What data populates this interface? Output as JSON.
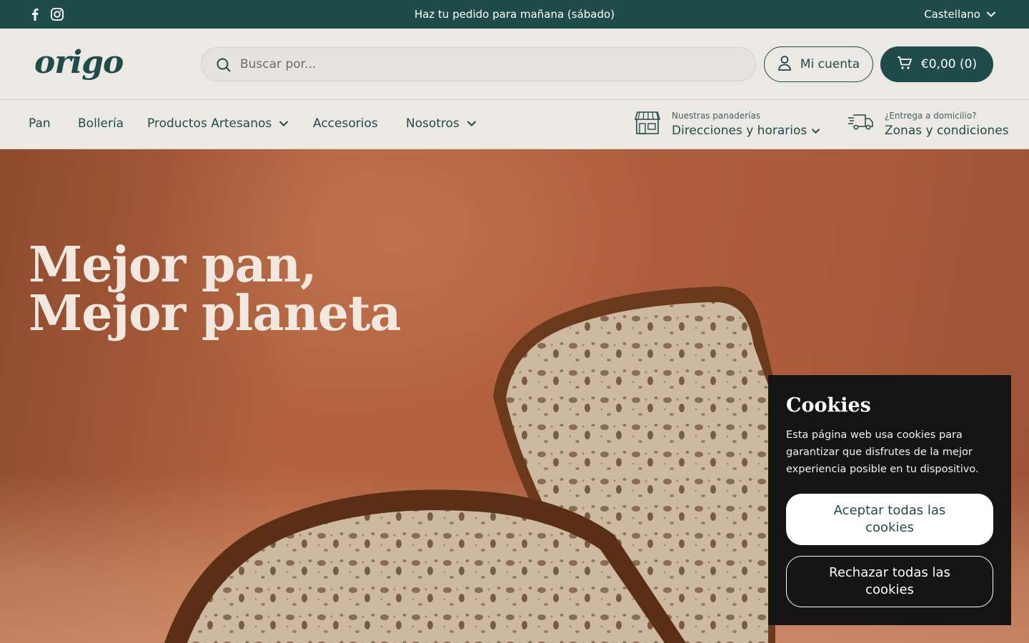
{
  "topbar": {
    "announcement": "Haz tu pedido para mañana (sábado)",
    "language": "Castellano",
    "social": [
      "facebook-icon",
      "instagram-icon"
    ]
  },
  "header": {
    "logo": "origo",
    "search_placeholder": "Buscar por...",
    "account_label": "Mi cuenta",
    "cart_label": "€0,00 (0)"
  },
  "nav": {
    "items": [
      {
        "label": "Pan",
        "dropdown": false
      },
      {
        "label": "Bollería",
        "dropdown": false
      },
      {
        "label": "Productos Artesanos",
        "dropdown": true
      },
      {
        "label": "Accesorios",
        "dropdown": false
      },
      {
        "label": "Nosotros",
        "dropdown": true
      }
    ],
    "stores": {
      "small": "Nuestras panaderías",
      "big": "Direcciones y horarios"
    },
    "delivery": {
      "small": "¿Entrega a domicilio?",
      "big": "Zonas y condiciones"
    }
  },
  "hero": {
    "line1": "Mejor pan,",
    "line2": "Mejor planeta"
  },
  "cookie": {
    "title": "Cookies",
    "text": "Esta página web usa cookies para garantizar que disfrutes de la mejor experiencia posible en tu dispositivo.",
    "accept": "Aceptar todas las cookies",
    "reject": "Rechazar todas las cookies"
  },
  "colors": {
    "brand": "#1f4b4a",
    "background": "#ece8e3",
    "hero": "#b05f3d",
    "cookie_bg": "#141414"
  }
}
